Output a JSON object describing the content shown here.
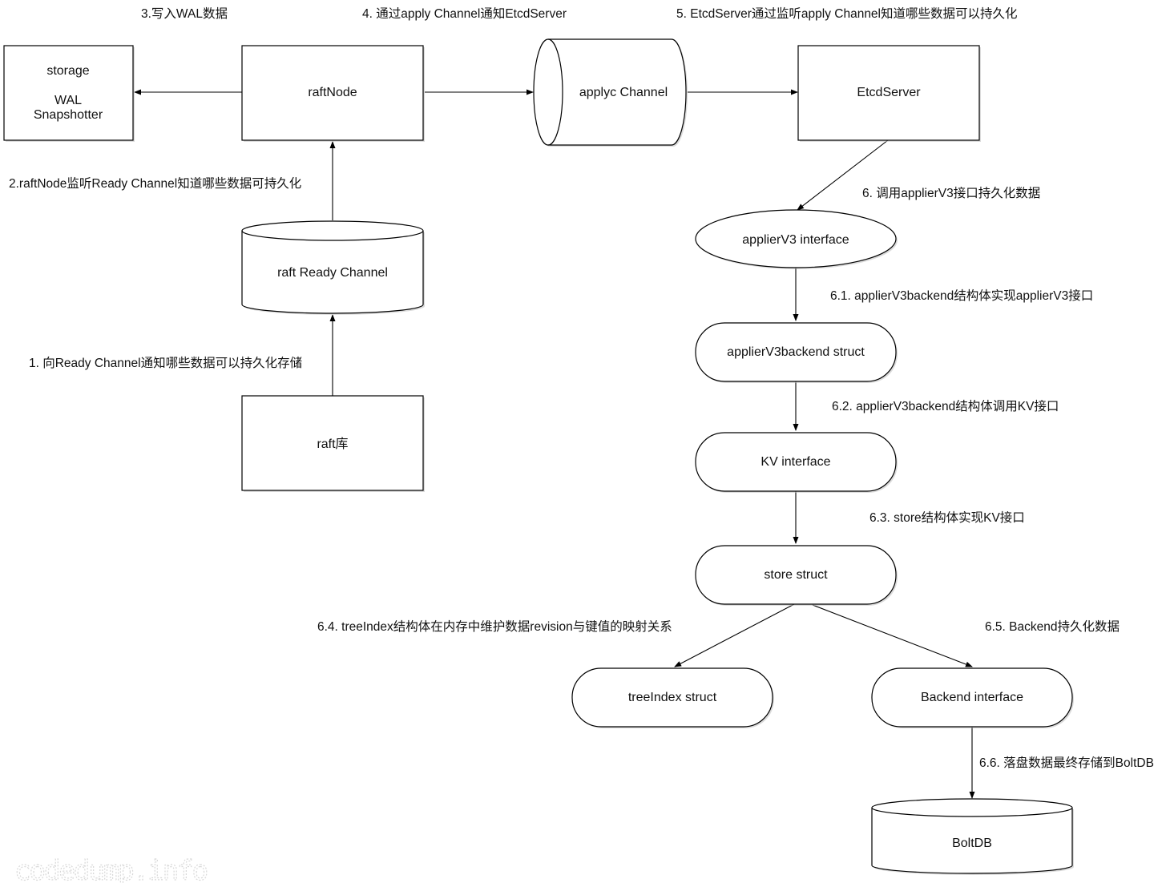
{
  "diagram": {
    "colors": {
      "stroke": "#000000",
      "fill": "#ffffff",
      "text": "#111111",
      "watermark": "#d8d8d8"
    },
    "nodes": {
      "storage": {
        "line1": "storage",
        "line2": "WAL",
        "line3": "Snapshotter"
      },
      "raftNode": {
        "label": "raftNode"
      },
      "applyChannel": {
        "label": "applyc Channel"
      },
      "etcdServer": {
        "label": "EtcdServer"
      },
      "raftReadyChannel": {
        "label": "raft Ready Channel"
      },
      "raftLib": {
        "label": "raft库"
      },
      "applierV3Interface": {
        "label": "applierV3 interface"
      },
      "applierV3Backend": {
        "label": "applierV3backend struct"
      },
      "kvInterface": {
        "label": "KV interface"
      },
      "storeStruct": {
        "label": "store struct"
      },
      "treeIndex": {
        "label": "treeIndex struct"
      },
      "backendInterface": {
        "label": "Backend interface"
      },
      "boltDB": {
        "label": "BoltDB"
      }
    },
    "edge_labels": {
      "step1": "1. 向Ready Channel通知哪些数据可以持久化存储",
      "step2": "2.raftNode监听Ready Channel知道哪些数据可持久化",
      "step3": "3.写入WAL数据",
      "step4": "4. 通过apply Channel通知EtcdServer",
      "step5": "5. EtcdServer通过监听apply Channel知道哪些数据可以持久化",
      "step6": "6. 调用applierV3接口持久化数据",
      "step6_1": "6.1. applierV3backend结构体实现applierV3接口",
      "step6_2": "6.2. applierV3backend结构体调用KV接口",
      "step6_3": "6.3. store结构体实现KV接口",
      "step6_4": "6.4. treeIndex结构体在内存中维护数据revision与键值的映射关系",
      "step6_5": "6.5. Backend持久化数据",
      "step6_6": "6.6. 落盘数据最终存储到BoltDB"
    },
    "watermark": "codedump.info"
  }
}
